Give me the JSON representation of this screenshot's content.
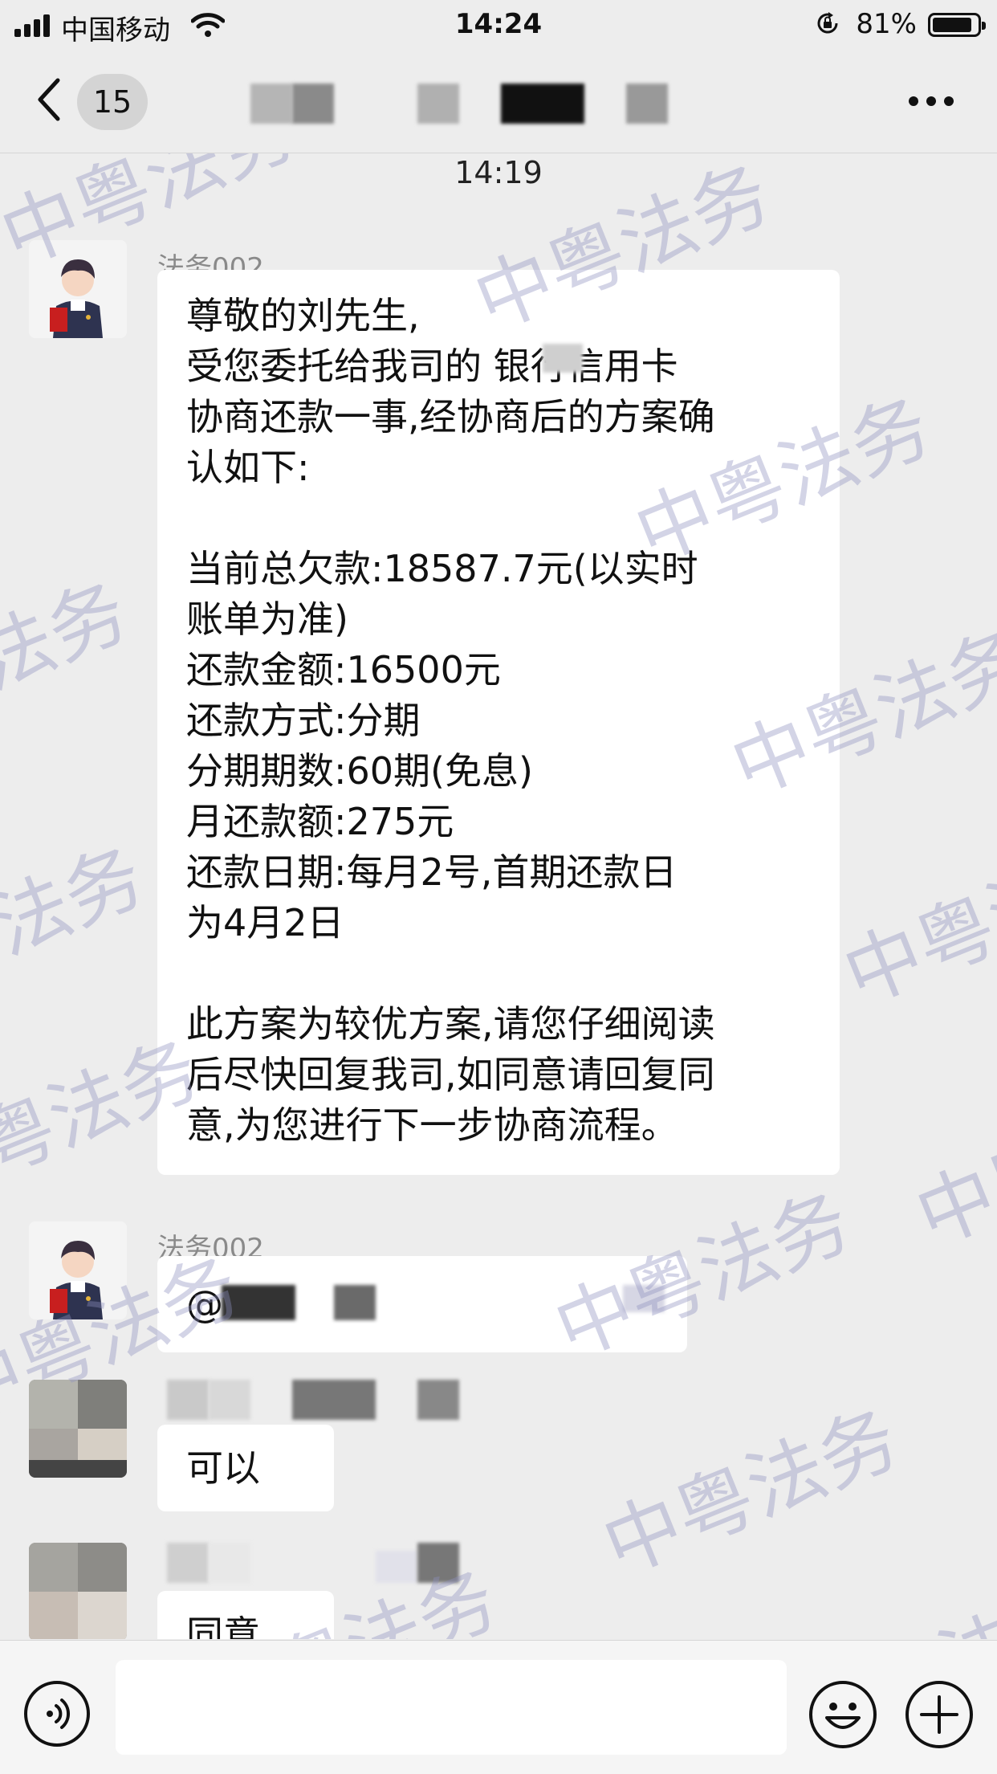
{
  "status_bar": {
    "carrier": "中国移动",
    "time": "14:24",
    "battery_percent": "81%",
    "battery_level": 0.81,
    "icons": [
      "signal-icon",
      "wifi-icon",
      "rotation-lock-icon",
      "battery-icon"
    ]
  },
  "nav": {
    "back_icon": "chevron-left-icon",
    "unread_count": "15",
    "more_icon": "more-dots-icon"
  },
  "chat": {
    "timestamp": "14:19",
    "watermark": "中粤法务",
    "messages": [
      {
        "sender": "法务002",
        "lines": [
          "尊敬的刘先生,",
          "受您委托给我司的 银行信用卡",
          "协商还款一事,经协商后的方案确",
          "认如下:",
          "",
          "当前总欠款:18587.7元(以实时",
          "账单为准)",
          "还款金额:16500元",
          "还款方式:分期",
          "分期期数:60期(免息)",
          "月还款额:275元",
          "还款日期:每月2号,首期还款日",
          "为4月2日",
          "",
          "此方案为较优方案,请您仔细阅读",
          "后尽快回复我司,如同意请回复同",
          "意,为您进行下一步协商流程。"
        ]
      },
      {
        "sender": "法务002",
        "text": "@"
      },
      {
        "text": "可以"
      },
      {
        "text": "同意"
      }
    ]
  },
  "input_bar": {
    "voice_icon": "voice-icon",
    "emoji_icon": "emoji-icon",
    "plus_icon": "plus-icon"
  }
}
